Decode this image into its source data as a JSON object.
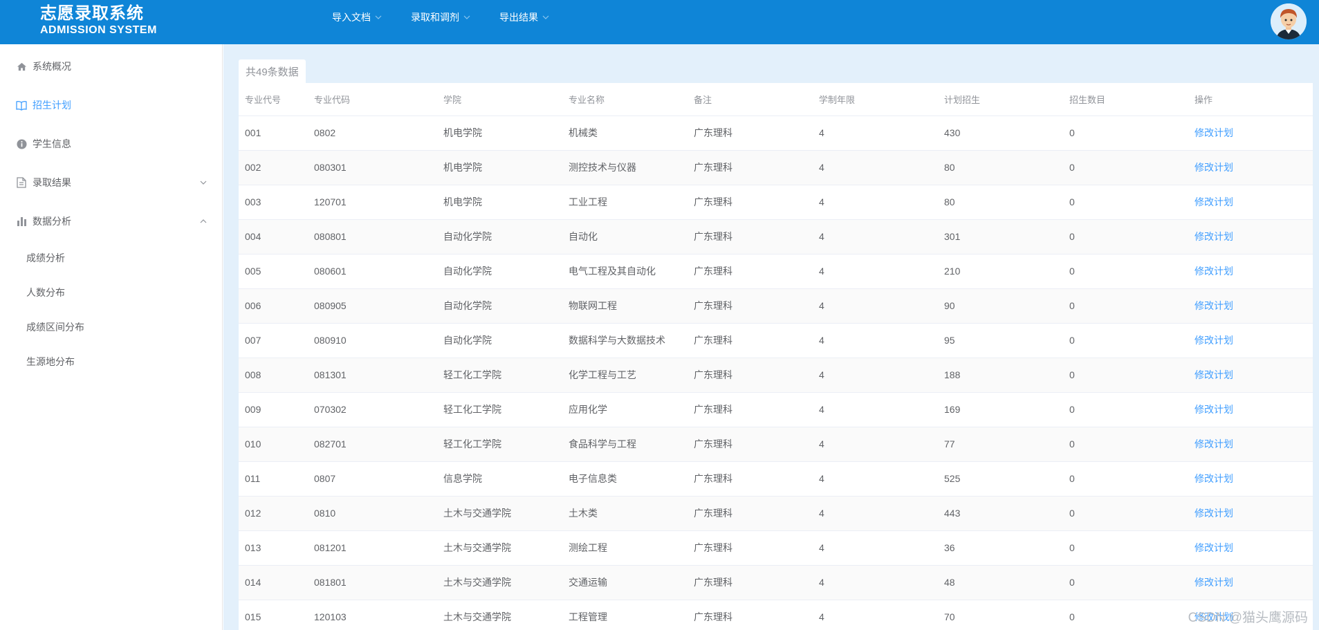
{
  "header": {
    "brand_cn": "志愿录取系统",
    "brand_en": "ADMISSION SYSTEM",
    "nav": [
      {
        "label": "导入文档"
      },
      {
        "label": "录取和调剂"
      },
      {
        "label": "导出结果"
      }
    ],
    "color": "#0f85d7"
  },
  "sidebar": {
    "items": [
      {
        "label": "系统概况",
        "icon": "home-icon"
      },
      {
        "label": "招生计划",
        "icon": "book-icon",
        "active": true
      },
      {
        "label": "学生信息",
        "icon": "info-icon"
      },
      {
        "label": "录取结果",
        "icon": "document-icon",
        "expandable": true
      },
      {
        "label": "数据分析",
        "icon": "bar-chart-icon",
        "expanded": true
      }
    ],
    "submenu": [
      {
        "label": "成绩分析"
      },
      {
        "label": "人数分布"
      },
      {
        "label": "成绩区间分布"
      },
      {
        "label": "生源地分布"
      }
    ],
    "active_color": "#409eff"
  },
  "main": {
    "total_label": "共49条数据",
    "columns": [
      "专业代号",
      "专业代码",
      "学院",
      "专业名称",
      "备注",
      "学制年限",
      "计划招生",
      "招生数目",
      "操作"
    ],
    "rows": [
      [
        "001",
        "0802",
        "机电学院",
        "机械类",
        "广东理科",
        "4",
        "430",
        "0"
      ],
      [
        "002",
        "080301",
        "机电学院",
        "测控技术与仪器",
        "广东理科",
        "4",
        "80",
        "0"
      ],
      [
        "003",
        "120701",
        "机电学院",
        "工业工程",
        "广东理科",
        "4",
        "80",
        "0"
      ],
      [
        "004",
        "080801",
        "自动化学院",
        "自动化",
        "广东理科",
        "4",
        "301",
        "0"
      ],
      [
        "005",
        "080601",
        "自动化学院",
        "电气工程及其自动化",
        "广东理科",
        "4",
        "210",
        "0"
      ],
      [
        "006",
        "080905",
        "自动化学院",
        "物联网工程",
        "广东理科",
        "4",
        "90",
        "0"
      ],
      [
        "007",
        "080910",
        "自动化学院",
        "数据科学与大数据技术",
        "广东理科",
        "4",
        "95",
        "0"
      ],
      [
        "008",
        "081301",
        "轻工化工学院",
        "化学工程与工艺",
        "广东理科",
        "4",
        "188",
        "0"
      ],
      [
        "009",
        "070302",
        "轻工化工学院",
        "应用化学",
        "广东理科",
        "4",
        "169",
        "0"
      ],
      [
        "010",
        "082701",
        "轻工化工学院",
        "食品科学与工程",
        "广东理科",
        "4",
        "77",
        "0"
      ],
      [
        "011",
        "0807",
        "信息学院",
        "电子信息类",
        "广东理科",
        "4",
        "525",
        "0"
      ],
      [
        "012",
        "0810",
        "土木与交通学院",
        "土木类",
        "广东理科",
        "4",
        "443",
        "0"
      ],
      [
        "013",
        "081201",
        "土木与交通学院",
        "测绘工程",
        "广东理科",
        "4",
        "36",
        "0"
      ],
      [
        "014",
        "081801",
        "土木与交通学院",
        "交通运输",
        "广东理科",
        "4",
        "48",
        "0"
      ],
      [
        "015",
        "120103",
        "土木与交通学院",
        "工程管理",
        "广东理科",
        "4",
        "70",
        "0"
      ]
    ],
    "action_label": "修改计划",
    "link_color": "#409eff"
  },
  "watermark": "CSDN @猫头鹰源码"
}
